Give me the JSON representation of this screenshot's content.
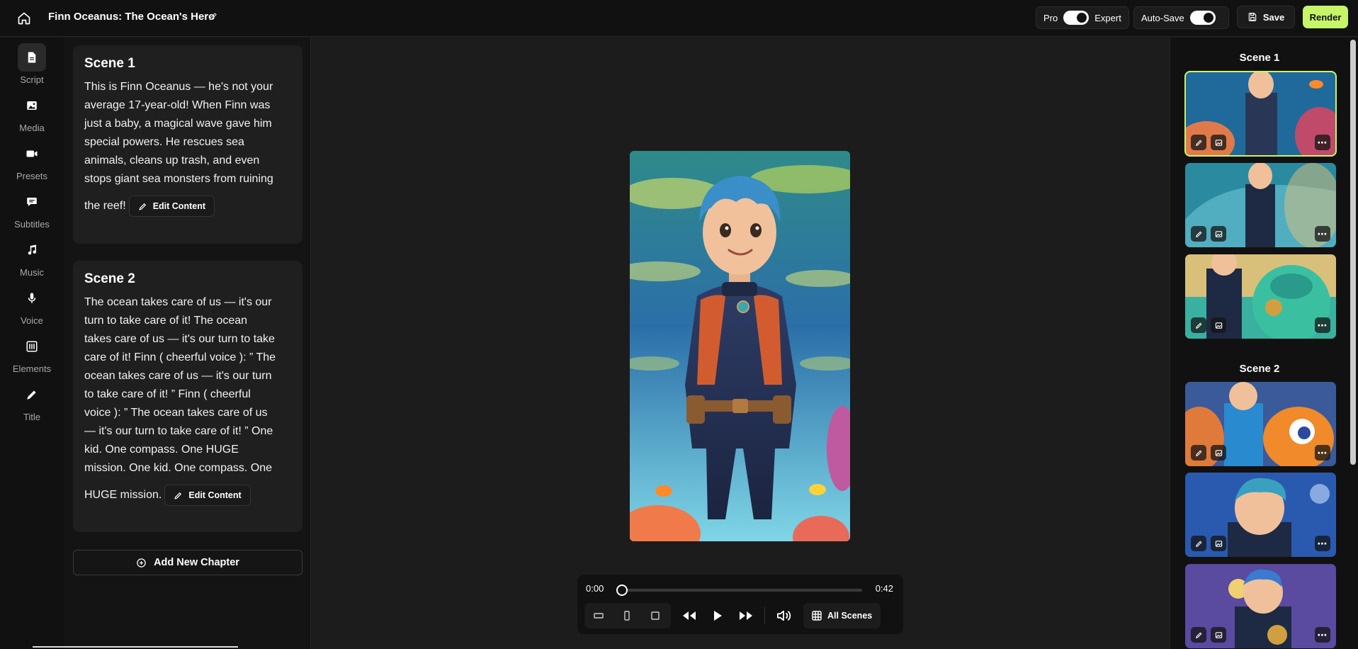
{
  "header": {
    "project_title": "Finn Oceanus: The Ocean's Hero",
    "mode_left": "Pro",
    "mode_right": "Expert",
    "autosave_label": "Auto-Save",
    "save_label": "Save",
    "render_label": "Render"
  },
  "rail": {
    "items": [
      {
        "label": "Script",
        "icon": "file-icon"
      },
      {
        "label": "Media",
        "icon": "image-icon"
      },
      {
        "label": "Presets",
        "icon": "video-icon"
      },
      {
        "label": "Subtitles",
        "icon": "chat-icon"
      },
      {
        "label": "Music",
        "icon": "music-note-icon"
      },
      {
        "label": "Voice",
        "icon": "microphone-icon"
      },
      {
        "label": "Elements",
        "icon": "elements-icon"
      },
      {
        "label": "Title",
        "icon": "pen-icon"
      }
    ]
  },
  "script": {
    "scenes": [
      {
        "title": "Scene 1",
        "lines": [
          "This is Finn Oceanus — he's not your",
          "average 17-year-old! When Finn was",
          "just a baby, a magical wave gave him",
          "special powers. He rescues sea",
          "animals, cleans up trash, and even",
          "stops giant sea monsters from ruining"
        ],
        "last_line": "the reef!",
        "edit_label": "Edit Content"
      },
      {
        "title": "Scene 2",
        "lines": [
          "The ocean takes care of us — it's our",
          "turn to take care of it! The ocean",
          "takes care of us — it's our turn to take",
          "care of it! Finn ( cheerful voice ): ” The",
          "ocean takes care of us — it's our turn",
          "to take care of it! ” Finn ( cheerful",
          "voice ): ” The ocean takes care of us",
          "— it's our turn to take care of it! ” One",
          "kid. One compass. One HUGE",
          "mission. One kid. One compass. One"
        ],
        "last_line": "HUGE mission.",
        "edit_label": "Edit Content"
      }
    ],
    "add_chapter_label": "Add New Chapter"
  },
  "player": {
    "current_time": "0:00",
    "duration": "0:42",
    "progress": 0,
    "all_scenes_label": "All Scenes"
  },
  "right": {
    "scene1_label": "Scene 1",
    "scene2_label": "Scene 2"
  },
  "colors": {
    "accent": "#c7f56a",
    "background": "#1a1a1a"
  }
}
